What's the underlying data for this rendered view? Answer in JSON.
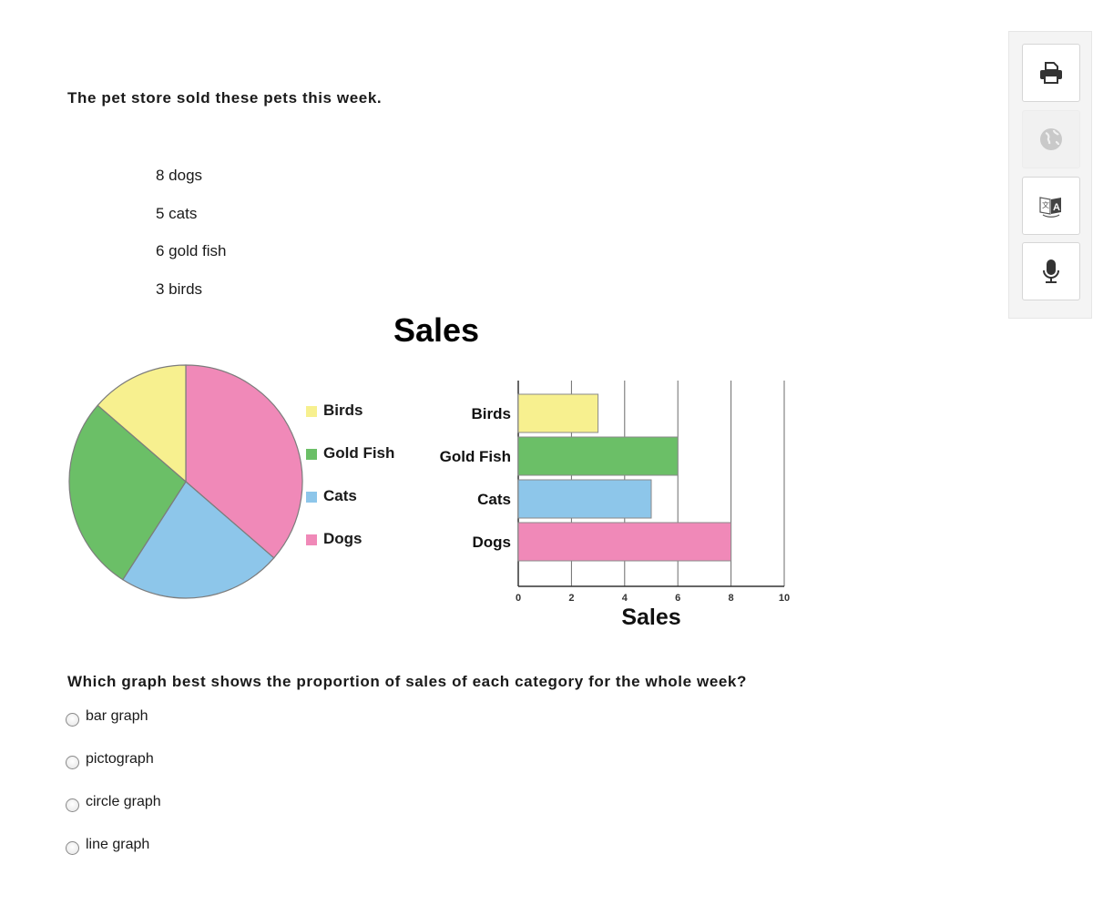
{
  "intro": "The pet store sold these pets this week.",
  "facts": [
    "8 dogs",
    "5 cats",
    "6 gold fish",
    "3 birds"
  ],
  "chart_title": "Sales",
  "chart_data": [
    {
      "type": "pie",
      "title": "Sales",
      "categories": [
        "Birds",
        "Gold Fish",
        "Cats",
        "Dogs"
      ],
      "values": [
        3,
        6,
        5,
        8
      ],
      "colors": [
        "#f7f08f",
        "#6bbf67",
        "#8dc6ea",
        "#f089b8"
      ],
      "legend": [
        "Birds",
        "Gold Fish",
        "Cats",
        "Dogs"
      ],
      "legend_position": "right"
    },
    {
      "type": "bar",
      "orientation": "horizontal",
      "title": "Sales",
      "categories": [
        "Birds",
        "Gold Fish",
        "Cats",
        "Dogs"
      ],
      "values": [
        3,
        6,
        5,
        8
      ],
      "colors": [
        "#f7f08f",
        "#6bbf67",
        "#8dc6ea",
        "#f089b8"
      ],
      "xlabel": "Sales",
      "ylabel": "",
      "xlim": [
        0,
        10
      ],
      "xticks": [
        "0",
        "2",
        "4",
        "6",
        "8",
        "10"
      ],
      "grid": true
    }
  ],
  "question": "Which graph best shows the proportion of sales of each category for the whole week?",
  "options": [
    "bar graph",
    "pictograph",
    "circle graph",
    "line graph"
  ],
  "toolbar": {
    "buttons": [
      {
        "name": "print",
        "enabled": true
      },
      {
        "name": "globe",
        "enabled": false
      },
      {
        "name": "translate",
        "enabled": true
      },
      {
        "name": "microphone",
        "enabled": true
      }
    ]
  }
}
